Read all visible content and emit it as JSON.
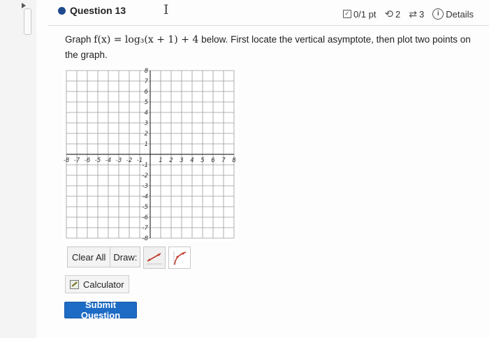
{
  "question": {
    "title": "Question 13",
    "points": "0/1 pt",
    "attempts": "2",
    "retries": "3",
    "details_label": "Details"
  },
  "prompt": {
    "lead": "Graph",
    "function": "f(x) = log₃(x + 1) + 4",
    "rest": "below. First locate the vertical asymptote, then plot two points on the graph."
  },
  "graph": {
    "x_range": [
      -8,
      8
    ],
    "y_range": [
      -8,
      8
    ],
    "x_tick_labels": [
      "-8",
      "-7",
      "-6",
      "-5",
      "-4",
      "-3",
      "-2",
      "-1",
      "1",
      "2",
      "3",
      "4",
      "5",
      "6",
      "7",
      "8"
    ],
    "y_tick_labels": [
      "8",
      "7",
      "6",
      "5",
      "4",
      "3",
      "2",
      "1",
      "-1",
      "-2",
      "-3",
      "-4",
      "-5",
      "-6",
      "-7",
      "-8"
    ],
    "grid": true
  },
  "toolbar": {
    "clear_all_label": "Clear All",
    "draw_label": "Draw:",
    "tools": [
      {
        "name": "line-tool",
        "active": true
      },
      {
        "name": "log-curve-tool",
        "active": false
      }
    ]
  },
  "calculator_label": "Calculator",
  "submit_label": "Submit Question",
  "colors": {
    "accent": "#1d6bc5",
    "question_dot": "#1e4a8e",
    "tool_stroke": "#c0392b"
  },
  "icons": {
    "points": "square-check-icon",
    "attempts": "undo-icon",
    "retries": "swap-icon",
    "details": "info-icon",
    "calculator": "calculator-icon"
  }
}
